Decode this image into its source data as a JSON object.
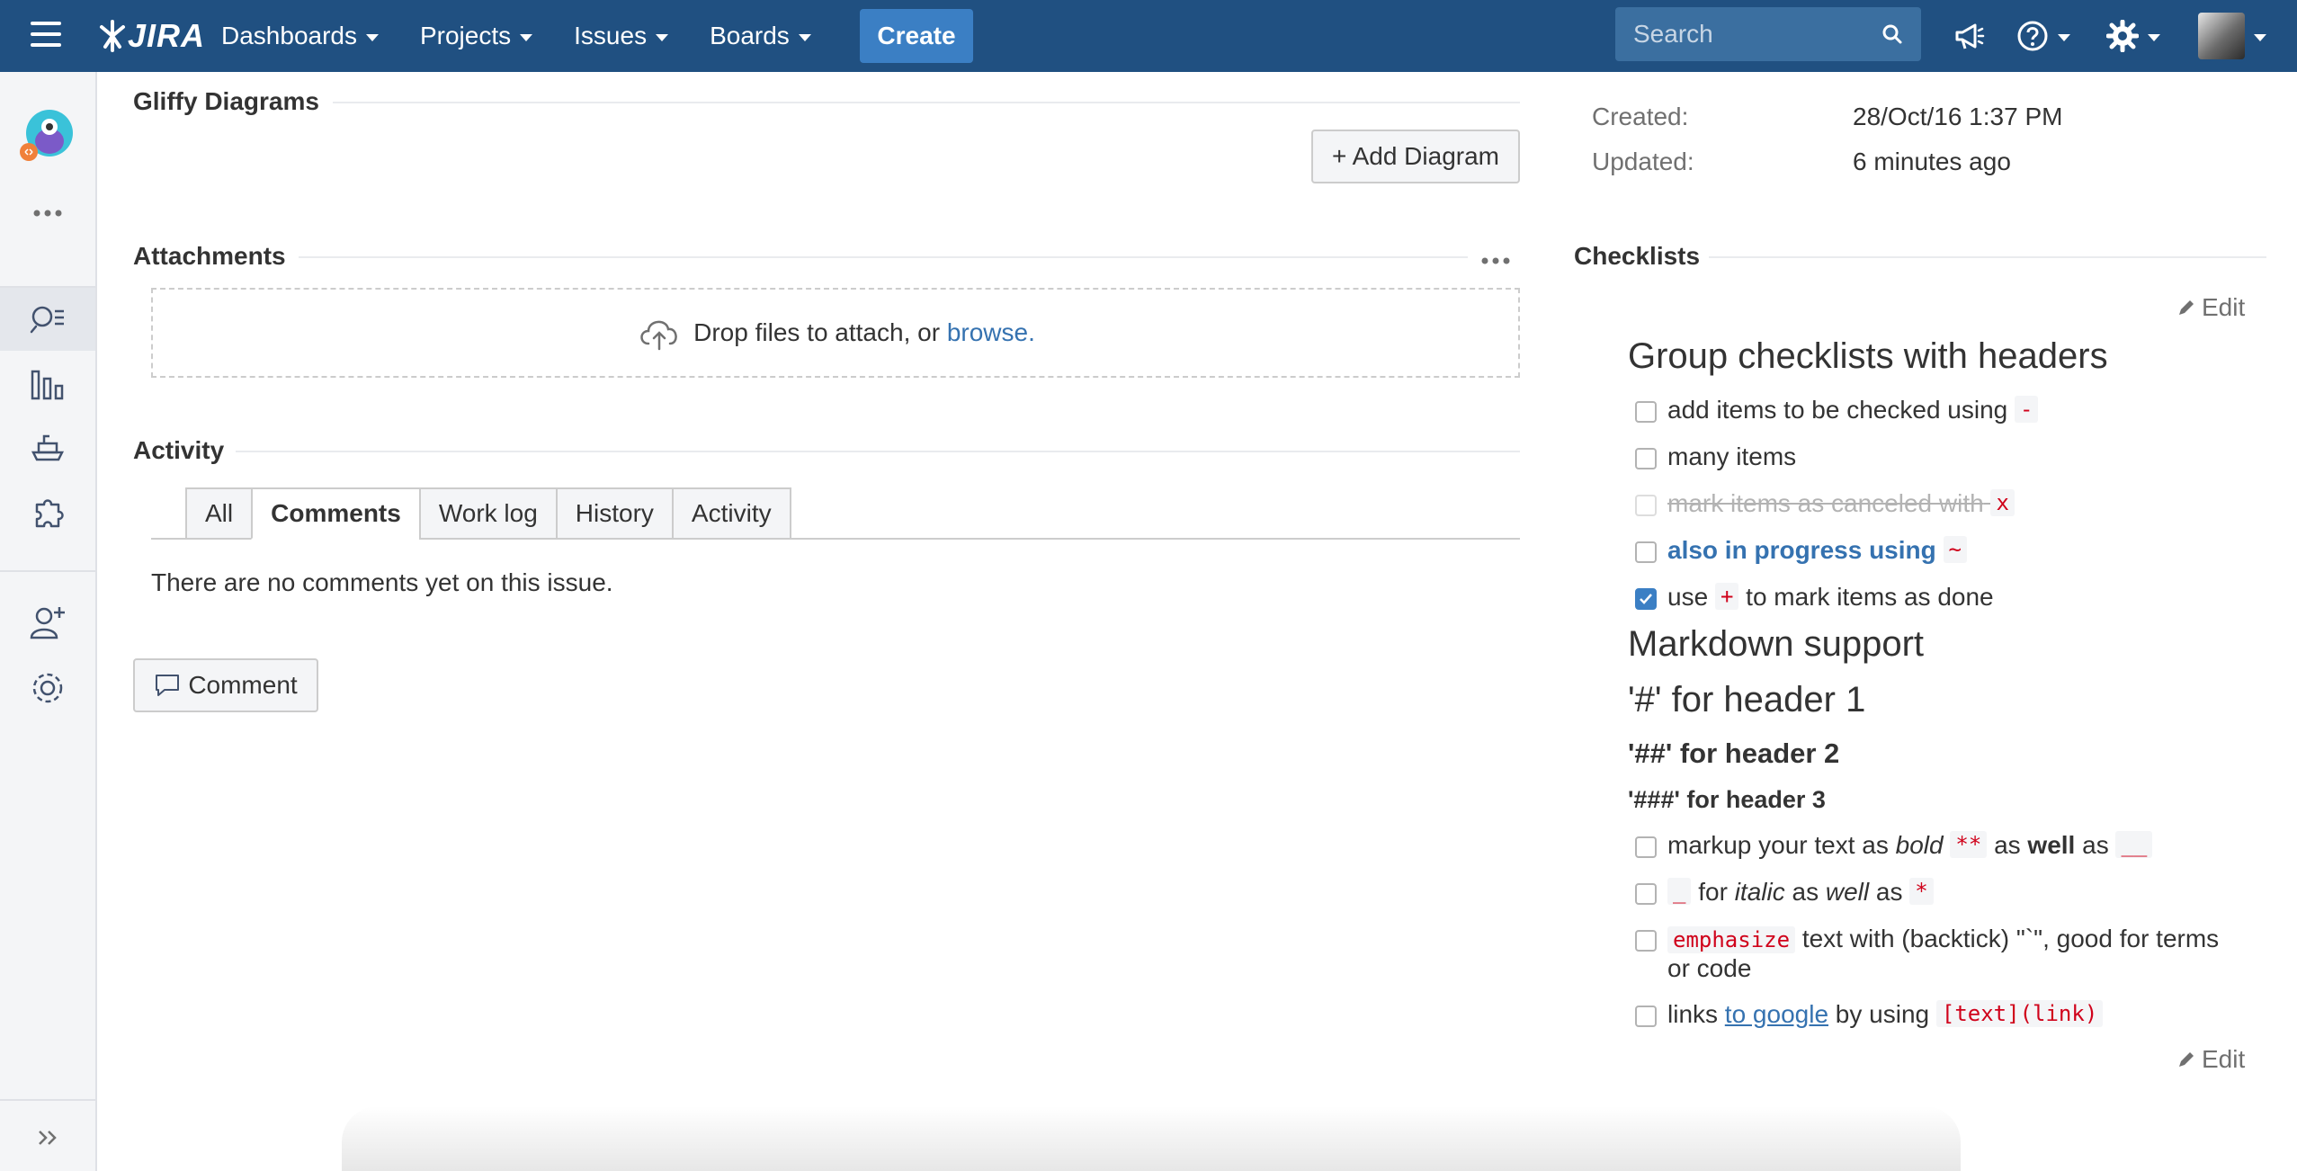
{
  "topbar": {
    "logo_text": "JIRA",
    "nav": [
      {
        "label": "Dashboards"
      },
      {
        "label": "Projects"
      },
      {
        "label": "Issues"
      },
      {
        "label": "Boards"
      }
    ],
    "create_label": "Create",
    "search_placeholder": "Search",
    "icons": [
      "menu-icon",
      "megaphone-icon",
      "help-icon",
      "settings-icon",
      "user-avatar"
    ],
    "bar_color": "#205081",
    "create_color": "#3b7fc4"
  },
  "sidebar": {
    "icons": [
      "project-avatar",
      "more-icon",
      "search-issues-icon",
      "reports-icon",
      "releases-icon",
      "add-ons-icon",
      "add-people-icon",
      "project-settings-icon",
      "expand-sidebar-icon"
    ]
  },
  "main": {
    "gliffy": {
      "title": "Gliffy Diagrams",
      "add_button": "+ Add Diagram"
    },
    "attachments": {
      "title": "Attachments",
      "drop_text": "Drop files to attach, or",
      "browse_link": "browse."
    },
    "activity": {
      "title": "Activity",
      "tabs": [
        {
          "label": "All"
        },
        {
          "label": "Comments"
        },
        {
          "label": "Work log"
        },
        {
          "label": "History"
        },
        {
          "label": "Activity"
        }
      ],
      "selected_tab": "Comments",
      "empty_text": "There are no comments yet on this issue.",
      "comment_button": "Comment"
    }
  },
  "details": {
    "created_label": "Created:",
    "created_value": "28/Oct/16 1:37 PM",
    "updated_label": "Updated:",
    "updated_value": "6 minutes ago"
  },
  "checklists": {
    "title": "Checklists",
    "edit_label": "Edit",
    "header_group": "Group checklists with headers",
    "items1": {
      "add": {
        "text": "add items to be checked using",
        "code": "-"
      },
      "many": {
        "text": "many items"
      },
      "canceled": {
        "text": "mark items as canceled with",
        "code": "x"
      },
      "progress": {
        "text": "also in progress using",
        "code": "~"
      },
      "done": {
        "pre": "use",
        "code": "+",
        "post": "to mark items as done",
        "checked": true
      }
    },
    "header_markdown": "Markdown support",
    "h1": "'#' for header 1",
    "h2": "'##' for header 2",
    "h3": "'###' for header 3",
    "items2": {
      "bold": {
        "t1": "markup your text as",
        "t2": "bold",
        "c1": "**",
        "t3": "as",
        "t4": "well",
        "t5": "as",
        "c2": "__"
      },
      "italic": {
        "c1": "_",
        "t1": "for",
        "t2": "italic",
        "t3": "as",
        "t4": "well",
        "t5": "as",
        "c2": "*"
      },
      "emph": {
        "code": "emphasize",
        "text": "text with (backtick) \"`\", good for terms or code"
      },
      "links": {
        "t1": "links",
        "link": "to google",
        "t2": "by using",
        "code": "[text](link)"
      }
    }
  }
}
